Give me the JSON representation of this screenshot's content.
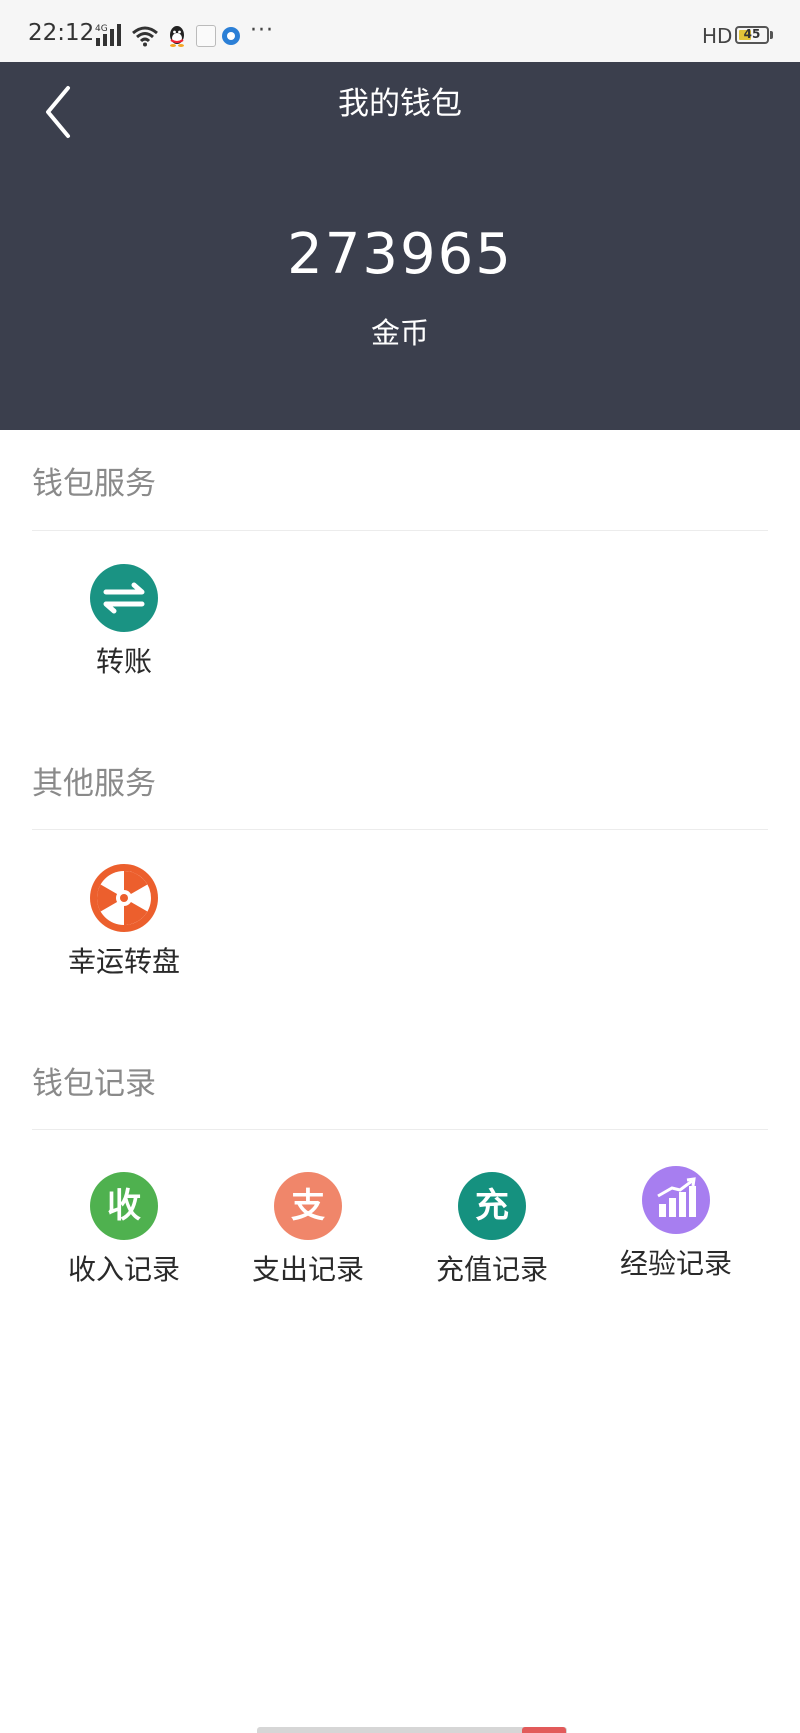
{
  "status_bar": {
    "time": "22:12",
    "network": "4G",
    "hd": "HD",
    "battery": 45,
    "more": "···"
  },
  "header": {
    "title": "我的钱包",
    "balance": "273965",
    "unit": "金币",
    "background_color": "#3b3f4d"
  },
  "sections": [
    {
      "title": "钱包服务",
      "items": [
        {
          "label": "转账",
          "icon": "transfer-arrows-icon",
          "color": "#1a9383"
        }
      ]
    },
    {
      "title": "其他服务",
      "items": [
        {
          "label": "幸运转盘",
          "icon": "lucky-wheel-icon",
          "color": "#ec5f2d"
        }
      ]
    },
    {
      "title": "钱包记录",
      "items": [
        {
          "label": "收入记录",
          "icon_text": "收",
          "icon": "income-icon",
          "color": "#4fb14f"
        },
        {
          "label": "支出记录",
          "icon_text": "支",
          "icon": "expense-icon",
          "color": "#f0866a"
        },
        {
          "label": "充值记录",
          "icon_text": "充",
          "icon": "recharge-icon",
          "color": "#15917f"
        },
        {
          "label": "经验记录",
          "icon": "bar-chart-icon",
          "color": "#a77ef0"
        }
      ]
    }
  ]
}
